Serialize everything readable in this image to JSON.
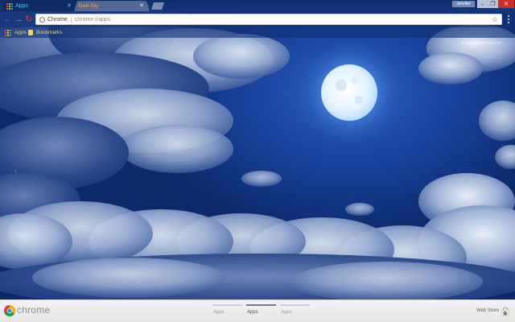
{
  "window": {
    "profile_label": "Jennifer",
    "minimize_glyph": "–",
    "maximize_glyph": "❐",
    "close_glyph": "✕"
  },
  "tabs": [
    {
      "label": "Apps",
      "icon": "apps-grid-icon",
      "close_glyph": "✕"
    },
    {
      "label": "Dark Sky",
      "icon": "chrome-icon",
      "close_glyph": "✕"
    }
  ],
  "toolbar": {
    "back_glyph": "←",
    "forward_glyph": "→",
    "reload_glyph": "↻",
    "chip_label": "Chrome",
    "url": "chrome://apps",
    "star_glyph": "☆"
  },
  "bookmarks": {
    "apps_label": "Apps",
    "bookmarks_label": "Bookmarks"
  },
  "page": {
    "credit": "© Sunlight-Themes Inc.",
    "left_arrow_glyph": "‹"
  },
  "footer": {
    "brand": "chrome",
    "pages": [
      {
        "label": "Apps",
        "active": false
      },
      {
        "label": "Apps",
        "active": true
      },
      {
        "label": "Apps",
        "active": false
      }
    ],
    "webstore_label": "Web Store"
  },
  "colors": {
    "sky": "#1a44a0",
    "moon": "#e8f4ff",
    "close_button": "#c9302c",
    "active_tab_text": "#4fc3f7",
    "inactive_tab_text": "#f7a838",
    "bookmark_text": "#f3d35a"
  }
}
